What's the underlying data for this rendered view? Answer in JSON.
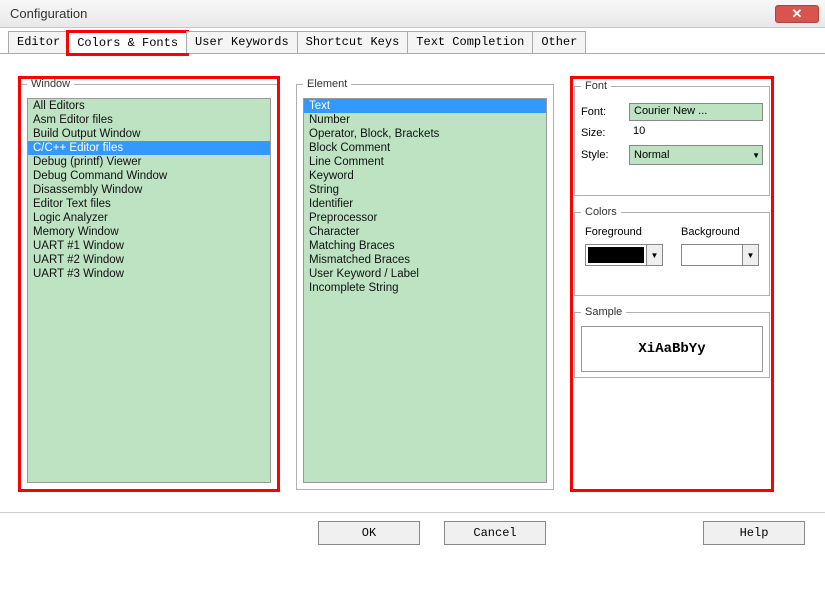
{
  "title": "Configuration",
  "tabs": [
    {
      "label": "Editor"
    },
    {
      "label": "Colors & Fonts",
      "active": true
    },
    {
      "label": "User Keywords"
    },
    {
      "label": "Shortcut Keys"
    },
    {
      "label": "Text Completion"
    },
    {
      "label": "Other"
    }
  ],
  "window_group": {
    "legend": "Window",
    "items": [
      "All Editors",
      "Asm Editor files",
      "Build Output Window",
      "C/C++ Editor files",
      "Debug (printf) Viewer",
      "Debug Command Window",
      "Disassembly Window",
      "Editor Text files",
      "Logic Analyzer",
      "Memory Window",
      "UART #1 Window",
      "UART #2 Window",
      "UART #3 Window"
    ],
    "selected_index": 3
  },
  "element_group": {
    "legend": "Element",
    "items": [
      "Text",
      "Number",
      "Operator, Block, Brackets",
      "Block Comment",
      "Line Comment",
      "Keyword",
      "String",
      "Identifier",
      "Preprocessor",
      "Character",
      "Matching Braces",
      "Mismatched Braces",
      "User Keyword / Label",
      "Incomplete String"
    ],
    "selected_index": 0
  },
  "font_group": {
    "legend": "Font",
    "font_label": "Font:",
    "font_value": "Courier New ...",
    "size_label": "Size:",
    "size_value": "10",
    "style_label": "Style:",
    "style_value": "Normal"
  },
  "colors_group": {
    "legend": "Colors",
    "fg_label": "Foreground",
    "bg_label": "Background",
    "fg_color": "#000000",
    "bg_color": "#ffffff"
  },
  "sample_group": {
    "legend": "Sample",
    "text": "XiAaBbYy"
  },
  "buttons": {
    "ok": "OK",
    "cancel": "Cancel",
    "help": "Help"
  }
}
